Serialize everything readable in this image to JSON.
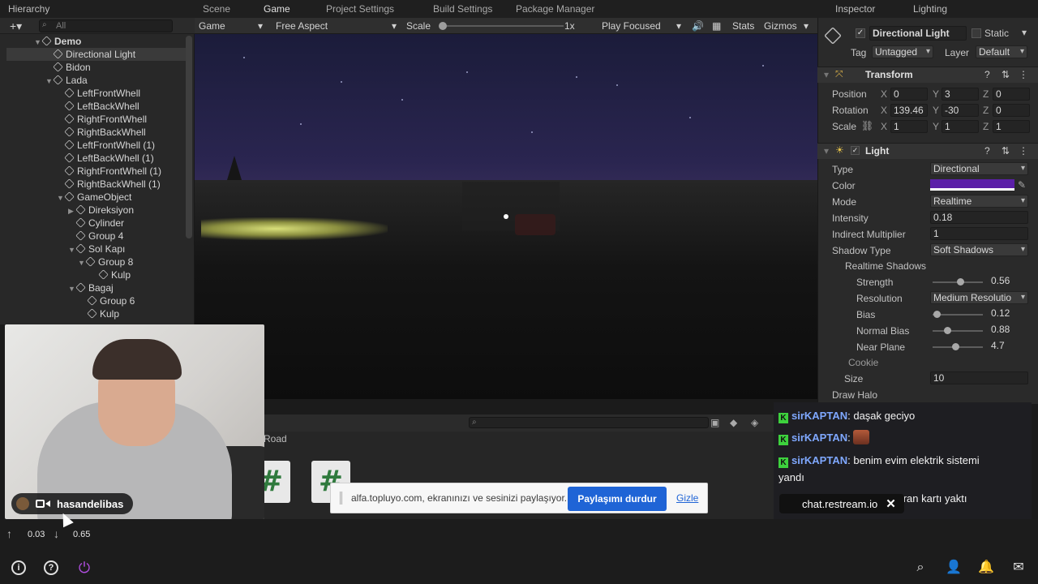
{
  "hierarchy": {
    "tab": "Hierarchy",
    "search_placeholder": "All",
    "items": [
      {
        "label": "Demo"
      },
      {
        "label": "Directional Light"
      },
      {
        "label": "Bidon"
      },
      {
        "label": "Lada"
      },
      {
        "label": "LeftFrontWhell"
      },
      {
        "label": "LeftBackWhell"
      },
      {
        "label": "RightFrontWhell"
      },
      {
        "label": "RightBackWhell"
      },
      {
        "label": "LeftFrontWhell (1)"
      },
      {
        "label": "LeftBackWhell (1)"
      },
      {
        "label": "RightFrontWhell (1)"
      },
      {
        "label": "RightBackWhell (1)"
      },
      {
        "label": "GameObject"
      },
      {
        "label": "Direksiyon"
      },
      {
        "label": "Cylinder"
      },
      {
        "label": "Group 4"
      },
      {
        "label": "Sol Kapı"
      },
      {
        "label": "Group 8"
      },
      {
        "label": "Kulp"
      },
      {
        "label": "Bagaj"
      },
      {
        "label": "Group 6"
      },
      {
        "label": "Kulp"
      }
    ]
  },
  "top_tabs": [
    "Scene",
    "Game",
    "Project Settings",
    "Build Settings",
    "Package Manager"
  ],
  "game_toolbar": {
    "display": "Game",
    "aspect": "Free Aspect",
    "scale_label": "Scale",
    "scale_value": "1x",
    "play_mode": "Play Focused",
    "stats": "Stats",
    "gizmos": "Gizmos"
  },
  "project": {
    "folder": "Road"
  },
  "inspector": {
    "tabs": [
      "Inspector",
      "Lighting"
    ],
    "object_name": "Directional Light",
    "static_label": "Static",
    "tag_label": "Tag",
    "tag_value": "Untagged",
    "layer_label": "Layer",
    "layer_value": "Default",
    "transform": {
      "title": "Transform",
      "position_label": "Position",
      "rotation_label": "Rotation",
      "scale_label": "Scale",
      "position": {
        "x": "0",
        "y": "3",
        "z": "0"
      },
      "rotation": {
        "x": "139.46",
        "y": "-30",
        "z": "0"
      },
      "scale": {
        "x": "1",
        "y": "1",
        "z": "1"
      }
    },
    "light": {
      "title": "Light",
      "type_label": "Type",
      "type_value": "Directional",
      "color_label": "Color",
      "color_value": "#5b1fa8",
      "mode_label": "Mode",
      "mode_value": "Realtime",
      "intensity_label": "Intensity",
      "intensity_value": "0.18",
      "indirect_label": "Indirect Multiplier",
      "indirect_value": "1",
      "shadow_type_label": "Shadow Type",
      "shadow_type_value": "Soft Shadows",
      "realtime_shadows_label": "Realtime Shadows",
      "strength_label": "Strength",
      "strength_value": "0.56",
      "resolution_label": "Resolution",
      "resolution_value": "Medium Resolutio",
      "bias_label": "Bias",
      "bias_value": "0.12",
      "normal_bias_label": "Normal Bias",
      "normal_bias_value": "0.88",
      "near_plane_label": "Near Plane",
      "near_plane_value": "4.7",
      "cookie_label": "Cookie",
      "size_label": "Size",
      "size_value": "10",
      "draw_halo_label": "Draw Halo"
    }
  },
  "webcam": {
    "name": "hasandelibas"
  },
  "share_bar": {
    "text": "alfa.topluyo.com, ekranınızı ve sesinizi paylaşıyor.",
    "stop_label": "Paylaşımı durdur",
    "hide_label": "Gizle"
  },
  "chat": {
    "messages": [
      {
        "user": "sirKAPTAN",
        "text": "daşak geciyo"
      },
      {
        "user": "sirKAPTAN",
        "text": ""
      },
      {
        "user": "sirKAPTAN",
        "text": "benim evim elektrik sistemi yandı"
      },
      {
        "user": "",
        "text": "ekran kartı yaktı"
      }
    ],
    "restream_label": "chat.restream.io"
  },
  "bottom_stats": {
    "up": "0.03",
    "down": "0.65"
  }
}
